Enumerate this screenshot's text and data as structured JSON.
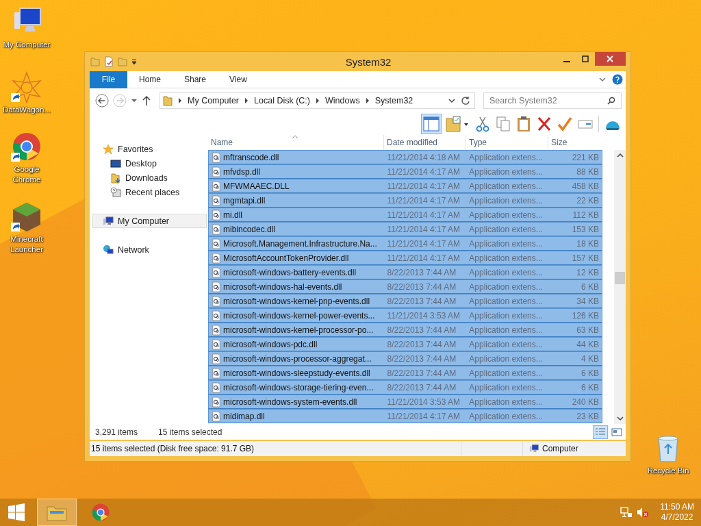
{
  "desktop_icons": [
    {
      "label": "My Computer",
      "kind": "computer",
      "shortcut": false
    },
    {
      "label": "DataWagon...",
      "kind": "star",
      "shortcut": true
    },
    {
      "label": "Google Chrome",
      "kind": "chrome",
      "shortcut": true
    },
    {
      "label": "Minecraft Launcher",
      "kind": "block",
      "shortcut": true
    }
  ],
  "recycle_bin": {
    "label": "Recycle Bin"
  },
  "window": {
    "title": "System32",
    "ribbon_tabs": [
      {
        "label": "File",
        "kind": "file"
      },
      {
        "label": "Home",
        "kind": "tab"
      },
      {
        "label": "Share",
        "kind": "tab"
      },
      {
        "label": "View",
        "kind": "tab"
      }
    ],
    "breadcrumbs": [
      "My Computer",
      "Local Disk (C:)",
      "Windows",
      "System32"
    ],
    "search": {
      "placeholder": "Search System32"
    },
    "navigation": [
      {
        "label": "Favorites",
        "kind": "star",
        "selected": false,
        "children": [
          {
            "label": "Desktop",
            "kind": "desktop",
            "selected": false
          },
          {
            "label": "Downloads",
            "kind": "downloads",
            "selected": false
          },
          {
            "label": "Recent places",
            "kind": "recent",
            "selected": false
          }
        ]
      },
      {
        "label": "My Computer",
        "kind": "computer",
        "selected": true
      },
      {
        "label": "Network",
        "kind": "network",
        "selected": false
      }
    ],
    "columns": [
      "Name",
      "Date modified",
      "Type",
      "Size"
    ],
    "rows": [
      {
        "name": "mftranscode.dll",
        "date": "11/21/2014 4:18 AM",
        "type": "Application extens...",
        "size": "221 KB",
        "selected": true
      },
      {
        "name": "mfvdsp.dll",
        "date": "11/21/2014 4:17 AM",
        "type": "Application extens...",
        "size": "88 KB",
        "selected": true
      },
      {
        "name": "MFWMAAEC.DLL",
        "date": "11/21/2014 4:17 AM",
        "type": "Application extens...",
        "size": "458 KB",
        "selected": true
      },
      {
        "name": "mgmtapi.dll",
        "date": "11/21/2014 4:17 AM",
        "type": "Application extens...",
        "size": "22 KB",
        "selected": true
      },
      {
        "name": "mi.dll",
        "date": "11/21/2014 4:17 AM",
        "type": "Application extens...",
        "size": "112 KB",
        "selected": true
      },
      {
        "name": "mibincodec.dll",
        "date": "11/21/2014 4:17 AM",
        "type": "Application extens...",
        "size": "153 KB",
        "selected": true
      },
      {
        "name": "Microsoft.Management.Infrastructure.Na...",
        "date": "11/21/2014 4:17 AM",
        "type": "Application extens...",
        "size": "18 KB",
        "selected": true
      },
      {
        "name": "MicrosoftAccountTokenProvider.dll",
        "date": "11/21/2014 4:17 AM",
        "type": "Application extens...",
        "size": "157 KB",
        "selected": true
      },
      {
        "name": "microsoft-windows-battery-events.dll",
        "date": "8/22/2013 7:44 AM",
        "type": "Application extens...",
        "size": "12 KB",
        "selected": true
      },
      {
        "name": "microsoft-windows-hal-events.dll",
        "date": "8/22/2013 7:44 AM",
        "type": "Application extens...",
        "size": "6 KB",
        "selected": true
      },
      {
        "name": "microsoft-windows-kernel-pnp-events.dll",
        "date": "8/22/2013 7:44 AM",
        "type": "Application extens...",
        "size": "34 KB",
        "selected": true
      },
      {
        "name": "microsoft-windows-kernel-power-events...",
        "date": "11/21/2014 3:53 AM",
        "type": "Application extens...",
        "size": "126 KB",
        "selected": true
      },
      {
        "name": "microsoft-windows-kernel-processor-po...",
        "date": "8/22/2013 7:44 AM",
        "type": "Application extens...",
        "size": "63 KB",
        "selected": true
      },
      {
        "name": "microsoft-windows-pdc.dll",
        "date": "8/22/2013 7:44 AM",
        "type": "Application extens...",
        "size": "44 KB",
        "selected": true
      },
      {
        "name": "microsoft-windows-processor-aggregat...",
        "date": "8/22/2013 7:44 AM",
        "type": "Application extens...",
        "size": "4 KB",
        "selected": true
      },
      {
        "name": "microsoft-windows-sleepstudy-events.dll",
        "date": "8/22/2013 7:44 AM",
        "type": "Application extens...",
        "size": "6 KB",
        "selected": true
      },
      {
        "name": "microsoft-windows-storage-tiering-even...",
        "date": "8/22/2013 7:44 AM",
        "type": "Application extens...",
        "size": "6 KB",
        "selected": true
      },
      {
        "name": "microsoft-windows-system-events.dll",
        "date": "11/21/2014 3:53 AM",
        "type": "Application extens...",
        "size": "240 KB",
        "selected": true
      },
      {
        "name": "midimap.dll",
        "date": "11/21/2014 4:17 AM",
        "type": "Application extens...",
        "size": "23 KB",
        "selected": true
      }
    ],
    "item_count": "3,291 items",
    "selection_count": "15 items selected",
    "views": [
      {
        "kind": "details",
        "selected": true
      },
      {
        "kind": "tiles",
        "selected": false
      }
    ],
    "status_bar": {
      "message": "15 items selected (Disk free space: 91.7 GB)",
      "location": "Computer"
    }
  },
  "taskbar": {
    "apps": [
      {
        "kind": "explorer",
        "selected": true
      },
      {
        "kind": "chrome",
        "selected": false
      }
    ],
    "time": "11:50 AM",
    "date": "4/7/2022"
  }
}
